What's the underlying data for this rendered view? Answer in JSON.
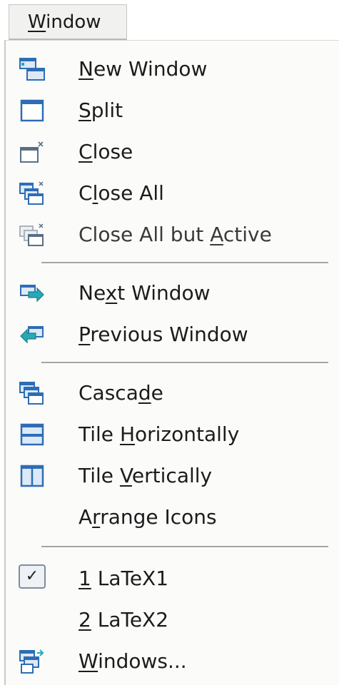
{
  "menu": {
    "title": {
      "pre": "",
      "u": "W",
      "post": "indow"
    }
  },
  "items": [
    {
      "icon": "new-window-icon",
      "label": {
        "pre": "",
        "u": "N",
        "post": "ew Window"
      }
    },
    {
      "icon": "split-icon",
      "label": {
        "pre": "",
        "u": "S",
        "post": "plit"
      }
    },
    {
      "icon": "close-window-icon",
      "label": {
        "pre": "",
        "u": "C",
        "post": "lose"
      }
    },
    {
      "icon": "close-all-icon",
      "label": {
        "pre": "C",
        "u": "l",
        "post": "ose All"
      }
    },
    {
      "icon": "close-all-but-active-icon",
      "label": {
        "pre": "Close All but ",
        "u": "A",
        "post": "ctive"
      }
    },
    {
      "icon": "next-window-icon",
      "label": {
        "pre": "Ne",
        "u": "x",
        "post": "t Window"
      }
    },
    {
      "icon": "previous-window-icon",
      "label": {
        "pre": "",
        "u": "P",
        "post": "revious Window"
      }
    },
    {
      "icon": "cascade-icon",
      "label": {
        "pre": "Casca",
        "u": "d",
        "post": "e"
      }
    },
    {
      "icon": "tile-horizontally-icon",
      "label": {
        "pre": "Tile ",
        "u": "H",
        "post": "orizontally"
      }
    },
    {
      "icon": "tile-vertically-icon",
      "label": {
        "pre": "Tile ",
        "u": "V",
        "post": "ertically"
      }
    },
    {
      "icon": "",
      "label": {
        "pre": "A",
        "u": "r",
        "post": "range Icons"
      }
    },
    {
      "icon": "checkmark-icon",
      "checked": true,
      "label": {
        "pre": "",
        "u": "1",
        "post": " LaTeX1"
      }
    },
    {
      "icon": "",
      "label": {
        "pre": "",
        "u": "2",
        "post": " LaTeX2"
      }
    },
    {
      "icon": "windows-list-icon",
      "label": {
        "pre": "",
        "u": "W",
        "post": "indows..."
      }
    }
  ],
  "colors": {
    "icon_blue": "#2e6db4",
    "icon_teal": "#27a9b5",
    "icon_light": "#dce9f7"
  }
}
